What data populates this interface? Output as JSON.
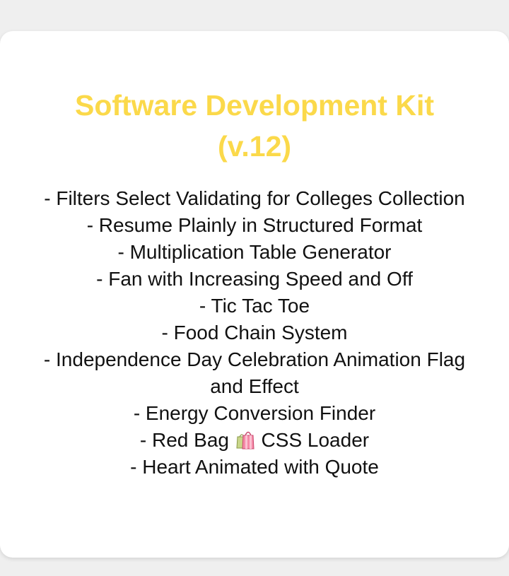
{
  "card": {
    "title_line1": "Software Development Kit",
    "title_line2": "(v.12)",
    "title_color": "#fbd94a",
    "items": [
      "- Filters Select Validating for Colleges Collection",
      "- Resume Plainly in Structured Format",
      "- Multiplication Table Generator",
      "- Fan with Increasing Speed and Off",
      "- Tic Tac Toe",
      "- Food Chain System",
      "- Independence Day Celebration Animation Flag and Effect",
      "- Energy Conversion Finder",
      "- Red Bag",
      "CSS Loader",
      "- Heart Animated with Quote"
    ],
    "bag_icon": "shopping-bags-icon"
  }
}
